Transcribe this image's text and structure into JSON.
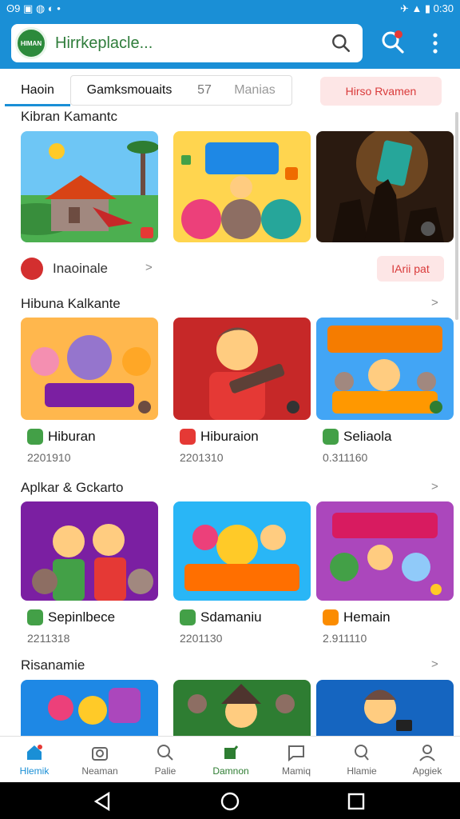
{
  "status": {
    "left": "ʘ9 ▣ ◍ ◐ •",
    "right": "✈ ▲ ▮ 0:30"
  },
  "search": {
    "logo": "HIMAN",
    "text": "Hirrkeplacle..."
  },
  "tabs": {
    "home": "Haoin",
    "games": "Gamksmouaits",
    "num": "57",
    "manias": "Manias",
    "red": "Hirso Rvamen"
  },
  "sections": [
    {
      "title": "Kibran Kamantc"
    },
    {
      "title": "Hibuna Kalkante"
    },
    {
      "title": "Aplkar & Gckarto"
    },
    {
      "title": "Risanamie"
    }
  ],
  "row": {
    "label": "Inaoinale",
    "badge": "IArii pat"
  },
  "apps_row2": [
    {
      "name": "Hiburan",
      "meta": "2201910"
    },
    {
      "name": "Hiburaion",
      "meta": "2201310"
    },
    {
      "name": "Seliaola",
      "meta": "0.311160"
    }
  ],
  "apps_row3": [
    {
      "name": "Sepinlbece",
      "meta": "2211318"
    },
    {
      "name": "Sdamaniu",
      "meta": "2201130"
    },
    {
      "name": "Hemain",
      "meta": "2.911110"
    }
  ],
  "bottomnav": [
    {
      "label": "Hlemik"
    },
    {
      "label": "Neaman"
    },
    {
      "label": "Palie"
    },
    {
      "label": "Damnon"
    },
    {
      "label": "Mamiq"
    },
    {
      "label": "Hlamie"
    },
    {
      "label": "Apgiek"
    }
  ],
  "colors": {
    "primary": "#1a8fd6",
    "accent_red": "#d32f2f",
    "green": "#2f7d3b"
  }
}
